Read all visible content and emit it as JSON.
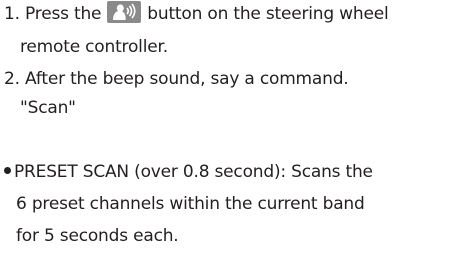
{
  "step1": {
    "number": "1.",
    "text_before": "Press the",
    "icon": "voice-recognition-button-icon",
    "text_after": "button on the steering wheel",
    "continuation": "remote controller."
  },
  "step2": {
    "number": "2.",
    "text": "After the beep sound, say a command.",
    "command": "\"Scan\""
  },
  "bullet": {
    "line1": "PRESET SCAN (over 0.8 second): Scans the",
    "line2": "6 preset channels within the current band",
    "line3": "for 5 seconds each."
  },
  "colors": {
    "text": "#231f20",
    "icon_bg": "#8a8a8a",
    "icon_fg": "#ffffff"
  }
}
